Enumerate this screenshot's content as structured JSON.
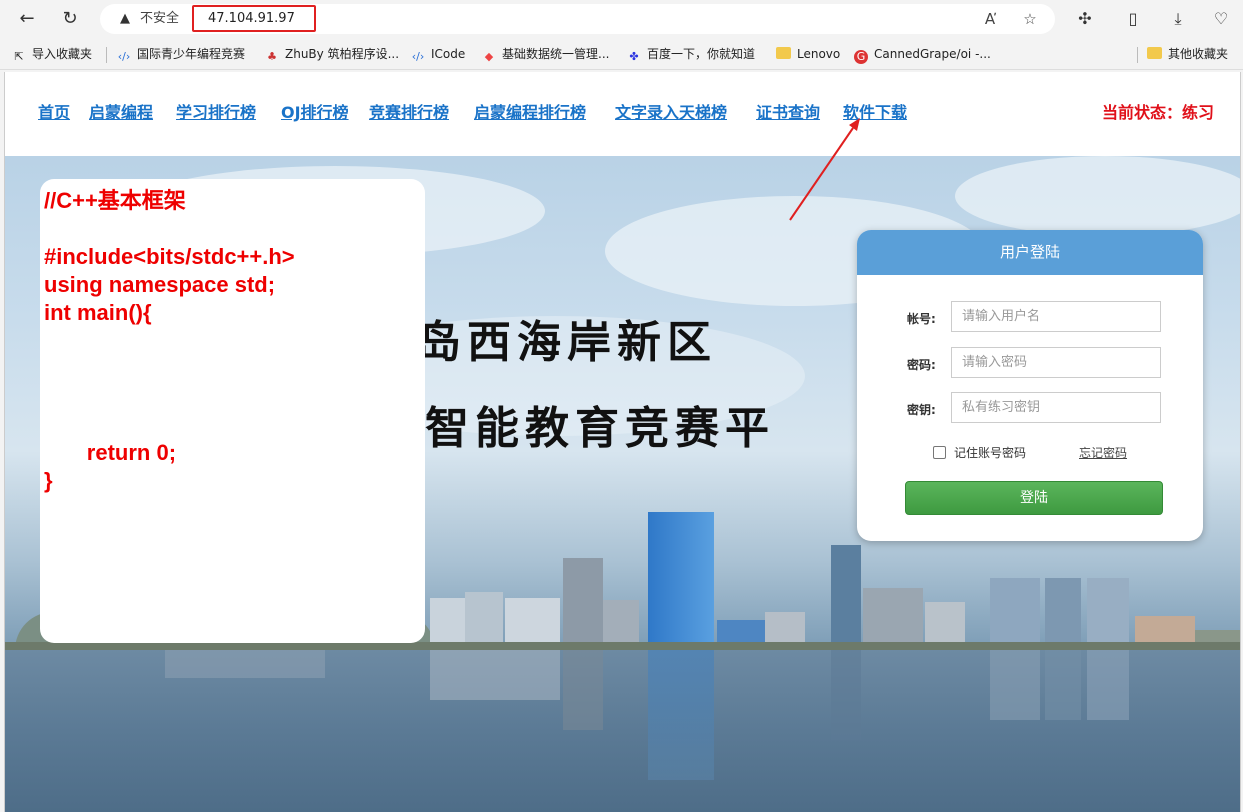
{
  "browser": {
    "security_label": "不安全",
    "url": "47.104.91.97"
  },
  "bookmarks": [
    {
      "label": "导入收藏夹"
    },
    {
      "label": "国际青少年编程竞赛"
    },
    {
      "label": "ZhuBy 筑柏程序设..."
    },
    {
      "label": "ICode"
    },
    {
      "label": "基础数据统一管理..."
    },
    {
      "label": "百度一下，你就知道"
    },
    {
      "label": "Lenovo"
    },
    {
      "label": "CannedGrape/oi -..."
    },
    {
      "label": "其他收藏夹"
    }
  ],
  "nav": {
    "items": [
      "首页",
      "启蒙编程",
      "学习排行榜",
      "OJ排行榜",
      "竞赛排行榜",
      "启蒙编程排行榜",
      "文字录入天梯榜",
      "证书查询",
      "软件下载"
    ],
    "status": "当前状态：练习"
  },
  "hero": {
    "line1": "青岛西海岸新区",
    "line2": "智能教育竞赛平"
  },
  "code": {
    "lines": [
      "//C++基本框架",
      "",
      "#include<bits/stdc++.h>",
      "using namespace std;",
      "int main(){",
      "",
      "",
      "",
      "",
      "       return 0;",
      "}"
    ]
  },
  "login": {
    "title": "用户登陆",
    "username_label": "帐号:",
    "username_placeholder": "请输入用户名",
    "password_label": "密码:",
    "password_placeholder": "请输入密码",
    "key_label": "密钥:",
    "key_placeholder": "私有练习密钥",
    "remember": "记住账号密码",
    "forgot": "忘记密码",
    "submit": "登陆"
  },
  "colors": {
    "nav_link": "#1a73c8",
    "status": "#e0101a",
    "code": "#ee0000",
    "login_header": "#5a9fd8",
    "login_button": "#4aa84c",
    "annotation": "#e02020"
  }
}
